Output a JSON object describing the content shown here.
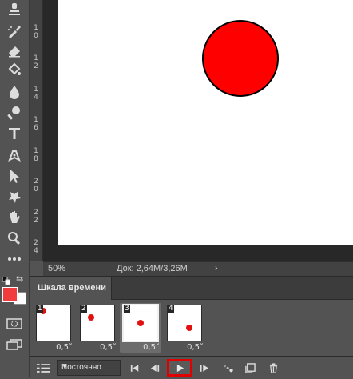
{
  "tools": [
    {
      "name": "stamp-tool-icon"
    },
    {
      "name": "healing-brush-icon"
    },
    {
      "name": "eraser-icon"
    },
    {
      "name": "paint-bucket-icon"
    },
    {
      "name": "blur-drop-icon"
    },
    {
      "name": "dodge-icon"
    },
    {
      "name": "type-tool-icon"
    },
    {
      "name": "pen-tool-icon"
    },
    {
      "name": "path-select-icon"
    },
    {
      "name": "custom-shape-icon"
    },
    {
      "name": "hand-tool-icon"
    },
    {
      "name": "zoom-tool-icon"
    },
    {
      "name": "more-tools-icon"
    }
  ],
  "ruler": {
    "labels": [
      "1\n0",
      "1\n2",
      "1\n4",
      "1\n6",
      "1\n8",
      "2\n0",
      "2\n2",
      "2\n4"
    ]
  },
  "status": {
    "zoom": "50%",
    "doc": "Док: 2,64M/3,26M",
    "arrow": "›"
  },
  "colors": {
    "foreground": "#f03c3c",
    "background": "#ffffff",
    "circle": "#fe0000"
  },
  "timeline": {
    "tab_label": "Шкала времени",
    "frames": [
      {
        "number": "1",
        "delay": "0,5",
        "selected": false
      },
      {
        "number": "2",
        "delay": "0,5",
        "selected": false
      },
      {
        "number": "3",
        "delay": "0,5",
        "selected": true
      },
      {
        "number": "4",
        "delay": "0,5",
        "selected": false
      }
    ],
    "loop_option": "Постоянно"
  }
}
